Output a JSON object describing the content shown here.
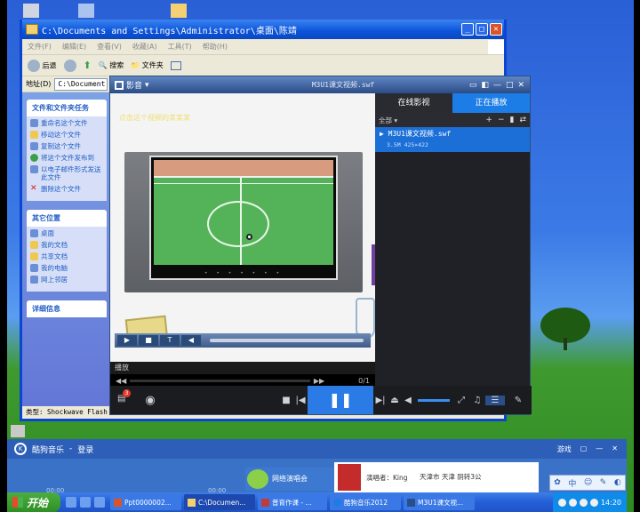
{
  "explorer": {
    "title": "C:\\Documents and Settings\\Administrator\\桌面\\陈靖",
    "menu": [
      "文件(F)",
      "编辑(E)",
      "查看(V)",
      "收藏(A)",
      "工具(T)",
      "帮助(H)"
    ],
    "toolbar": {
      "back": "后退",
      "search": "搜索",
      "folders": "文件夹"
    },
    "address_label": "地址(D)",
    "address_value": "C:\\Document",
    "file_tasks_title": "文件和文件夹任务",
    "file_tasks": [
      "重命名这个文件",
      "移动这个文件",
      "复制这个文件",
      "将这个文件发布到",
      "以电子邮件形式发送此文件",
      "删除这个文件"
    ],
    "other_places_title": "其它位置",
    "other_places": [
      "桌面",
      "我的文档",
      "共享文档",
      "我的电脑",
      "网上邻居"
    ],
    "details_title": "详细信息",
    "status_type": "类型: Shockwave Flash Ob"
  },
  "player": {
    "brand": "影音",
    "file_title": "M3U1课文视频.swf",
    "yellow_caption": "点击这个视频的某某某",
    "status_text": "播放",
    "progress": "0/1",
    "tabs": {
      "online": "在线影视",
      "playing": "正在播放"
    },
    "list_header": "全部",
    "list_ops": [
      "+",
      "−",
      "▮",
      "⇄"
    ],
    "playlist": [
      {
        "name": "M3U1课文视频.swf",
        "meta": "3.5M  425×422"
      }
    ]
  },
  "music": {
    "app_name": "酷狗音乐",
    "login": "登录",
    "right_items": [
      "游戏",
      "▢",
      "—",
      "✕"
    ],
    "concert": "网络演唱会",
    "singer": "演唱者：King",
    "weather": "天津市 天津 阴转3公",
    "time_left": "00:00",
    "time_right": "00:00"
  },
  "taskbar": {
    "start": "开始",
    "items": [
      {
        "label": "Ppt0000002...",
        "active": false
      },
      {
        "label": "C:\\Documen...",
        "active": true
      },
      {
        "label": "普育作课 - ...",
        "active": false
      },
      {
        "label": "酷狗音乐2012",
        "active": false
      },
      {
        "label": "M3U1课文视...",
        "active": false
      }
    ],
    "clock": "14:20"
  },
  "ime": {
    "label": "中"
  },
  "desktop_labels": {
    "icon1": "我的文档",
    "icon2": "DownView"
  },
  "colors": {
    "xp_blue": "#0b53d9",
    "player_accent": "#1c7de6",
    "play_button": "#2a7be6"
  }
}
